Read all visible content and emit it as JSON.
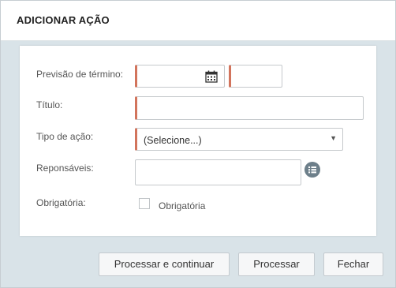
{
  "dialog": {
    "title": "ADICIONAR AÇÃO"
  },
  "form": {
    "previsao_label": "Previsão de término:",
    "titulo_label": "Título:",
    "tipo_label": "Tipo de ação:",
    "tipo_selected": "(Selecione...)",
    "responsaveis_label": "Reponsáveis:",
    "obrigatoria_label": "Obrigatória:",
    "obrigatoria_checkbox_label": "Obrigatória"
  },
  "buttons": {
    "processar_continuar": "Processar e continuar",
    "processar": "Processar",
    "fechar": "Fechar"
  },
  "colors": {
    "required_accent": "#d2745c",
    "footer_bg": "#d9e3e8",
    "icon_button_bg": "#6d7f8a"
  },
  "icons": {
    "date_picker": "calendar-icon",
    "responsaveis_picker": "list-icon",
    "select_toggle": "caret-down-icon"
  }
}
